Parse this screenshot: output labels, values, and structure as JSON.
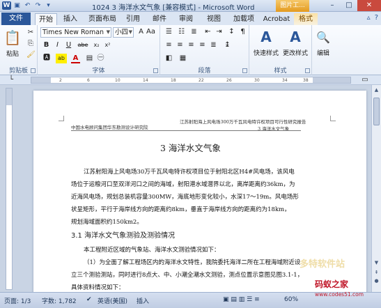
{
  "window": {
    "title": "1024 3 海洋水文气象 [兼容模式] - Microsoft Word",
    "context_tab_title": "图片工..."
  },
  "tabs": {
    "file": "文件",
    "items": [
      "开始",
      "插入",
      "页面布局",
      "引用",
      "邮件",
      "审阅",
      "视图",
      "加载项",
      "Acrobat",
      "格式"
    ]
  },
  "ribbon": {
    "clipboard": {
      "paste_label": "粘贴",
      "group_label": "剪贴板"
    },
    "font": {
      "font_name": "Times New Roman",
      "font_size": "小四",
      "bold": "B",
      "italic": "I",
      "underline": "U",
      "strike": "abe",
      "sub": "x₂",
      "sup": "x²",
      "highlight": "ab",
      "font_color": "A",
      "case": "Aa",
      "grow": "A",
      "group_label": "字体"
    },
    "paragraph": {
      "group_label": "段落"
    },
    "styles": {
      "quick_styles": "快速样式",
      "change_styles": "更改样式",
      "group_label": "样式"
    },
    "editing": {
      "label": "编辑"
    }
  },
  "document": {
    "header_left": "中国水电顾问集团华东勘测设计研究院",
    "header_right_line1": "江苏射阳海上风电场300万千瓦风电特许权项目可行性研究报告",
    "header_right_line2": "3    海洋水文气象",
    "chapter_title": "3    海洋水文气象",
    "paragraph1": [
      "江苏射阳海上风电场30万千瓦风电特许权项目位于射阳北区H4#风电场，该风电",
      "场位于运粮河口至双洋河口之间的海域，射阳港水域潜界以北，离岸距离约36km，为",
      "近海风电场，规划总装机容量300MW，海底地形变化较小，水深17～19m。风电场形",
      "状呈矩形，平行于海岸线方向的距离约8km，垂直于海岸线方向的距离约为18km，",
      "规划海域面积约150km2。"
    ],
    "section_title": "3.1    海洋水文气象测验及测验情况",
    "paragraph2": [
      "本工程附近区域的气象站、海洋水文测验情况如下：",
      "（1）为全面了解工程场区内的海洋水文特性，我院委托海洋二所在工程海域附近设",
      "立三个测验测站，同时进行8点大、中、小潮全潮水文测验，测点位置示意图见图3.1-1，",
      "具体资料情况如下："
    ]
  },
  "status": {
    "page": "页面: 1/3",
    "words": "字数: 1,782",
    "language": "英语(美国)",
    "mode": "插入",
    "zoom": "60%"
  },
  "watermark": {
    "text": "码蚁之家",
    "url": "www.codes51.com",
    "faint": "多特软件站"
  },
  "colors": {
    "accent": "#2b579a",
    "context": "#e39a1f",
    "watermark": "#c0182a"
  }
}
